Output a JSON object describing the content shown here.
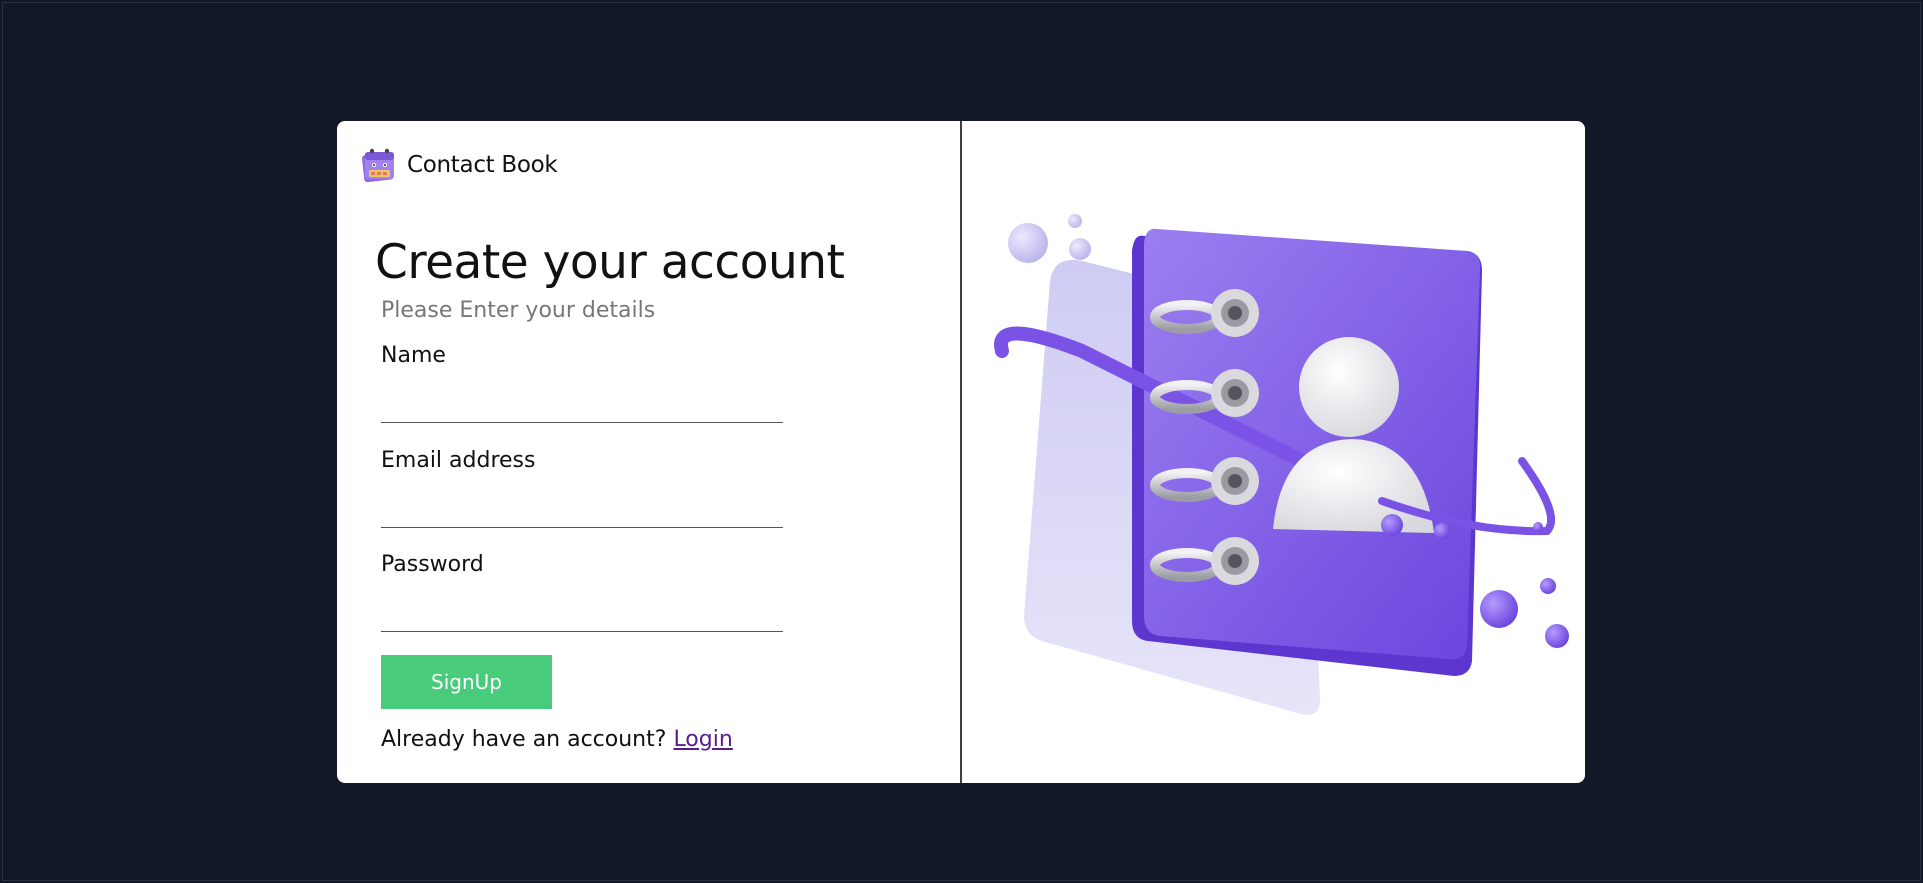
{
  "brand": {
    "name": "Contact Book",
    "logo_icon": "calendar-book-icon"
  },
  "form": {
    "title": "Create your account",
    "subtitle": "Please Enter your details",
    "fields": {
      "name": {
        "label": "Name",
        "value": "",
        "placeholder": ""
      },
      "email": {
        "label": "Email address",
        "value": "",
        "placeholder": ""
      },
      "password": {
        "label": "Password",
        "value": "",
        "placeholder": ""
      }
    },
    "submit_label": "SignUp",
    "login_prompt": "Already have an account?",
    "login_link": "Login"
  },
  "illustration": {
    "icon": "contact-book-illustration"
  },
  "colors": {
    "background": "#121827",
    "card": "#ffffff",
    "accent_purple": "#7c5ce6",
    "button_green": "#48cb7b",
    "link_purple": "#5a1e8a"
  }
}
